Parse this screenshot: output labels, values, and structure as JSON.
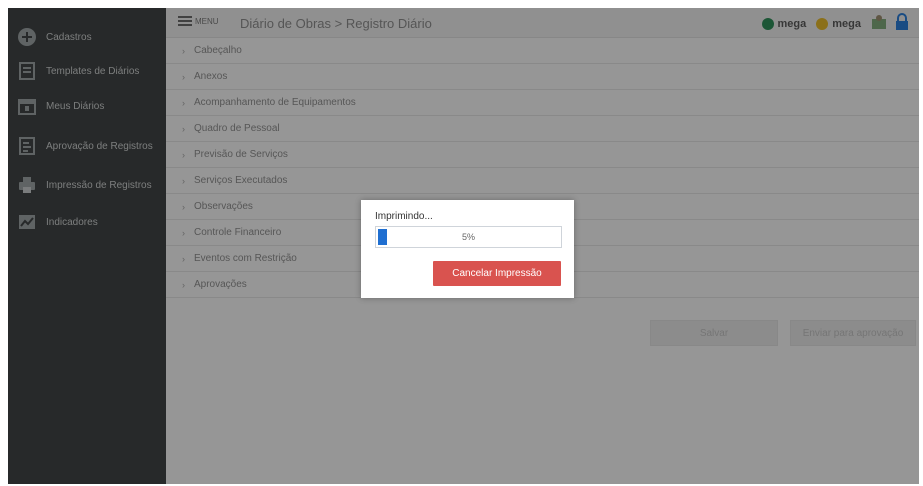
{
  "sidebar": {
    "items": [
      {
        "label": "Cadastros",
        "icon": "plus-circle-icon"
      },
      {
        "label": "Templates de Diários",
        "icon": "template-icon"
      },
      {
        "label": "Meus Diários",
        "icon": "calendar-icon"
      },
      {
        "label": "Aprovação de Registros",
        "icon": "approval-icon"
      },
      {
        "label": "Impressão de Registros",
        "icon": "printer-icon"
      },
      {
        "label": "Indicadores",
        "icon": "chart-icon"
      }
    ]
  },
  "header": {
    "menu_label": "MENU",
    "breadcrumb": "Diário de Obras > Registro Diário",
    "logos": [
      "mega",
      "mega"
    ]
  },
  "sections": [
    "Cabeçalho",
    "Anexos",
    "Acompanhamento de Equipamentos",
    "Quadro de Pessoal",
    "Previsão de Serviços",
    "Serviços Executados",
    "Observações",
    "Controle Financeiro",
    "Eventos com Restrição",
    "Aprovações"
  ],
  "actions": {
    "save_label": "Salvar",
    "send_label": "Enviar para aprovação"
  },
  "modal": {
    "title": "Imprimindo...",
    "progress_percent": 5,
    "progress_text": "5%",
    "cancel_label": "Cancelar Impressão"
  },
  "colors": {
    "sidebar_bg": "#3f4344",
    "progress_fill": "#1f6fd1",
    "cancel_button": "#d9534f"
  }
}
